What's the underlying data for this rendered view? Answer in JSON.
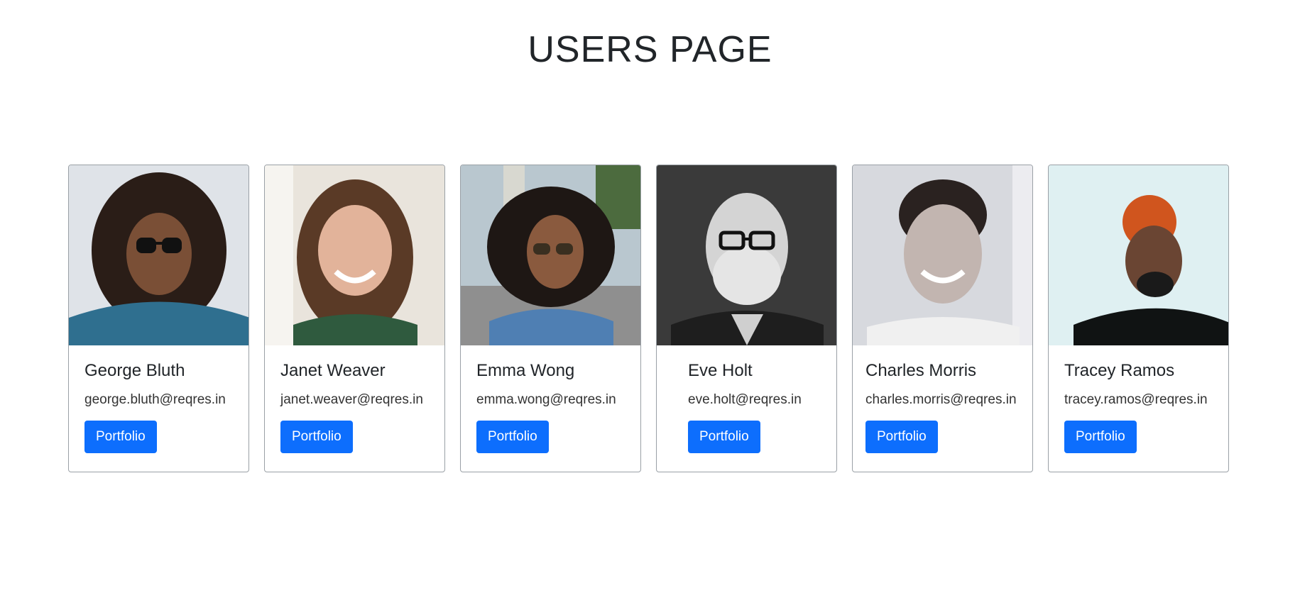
{
  "page": {
    "title": "USERS PAGE"
  },
  "users": [
    {
      "name": "George Bluth",
      "email": "george.bluth@reqres.in",
      "button_label": "Portfolio",
      "bg": "#dfe3e8",
      "skin": "#7a4f36",
      "hair": "#2a1d17",
      "shirt": "#2f6f8f"
    },
    {
      "name": "Janet Weaver",
      "email": "janet.weaver@reqres.in",
      "button_label": "Portfolio",
      "bg": "#e9e4dc",
      "skin": "#e2b39a",
      "hair": "#5a3a26",
      "shirt": "#2f5a3e"
    },
    {
      "name": "Emma Wong",
      "email": "emma.wong@reqres.in",
      "button_label": "Portfolio",
      "bg": "#b9c7cf",
      "skin": "#8a5a3e",
      "hair": "#1e1714",
      "shirt": "#4f7fb3"
    },
    {
      "name": "Eve Holt",
      "email": "eve.holt@reqres.in",
      "button_label": "Portfolio",
      "bg": "#3a3a3a",
      "skin": "#c9c9c9",
      "hair": "#e5e5e5",
      "shirt": "#1e1e1e"
    },
    {
      "name": "Charles Morris",
      "email": "charles.morris@reqres.in",
      "button_label": "Portfolio",
      "bg": "#d7d9de",
      "skin": "#c2b5b0",
      "hair": "#2a2220",
      "shirt": "#f0f0f0"
    },
    {
      "name": "Tracey Ramos",
      "email": "tracey.ramos@reqres.in",
      "button_label": "Portfolio",
      "bg": "#dff0f2",
      "skin": "#6a4533",
      "hair": "#d0551e",
      "shirt": "#101313"
    }
  ],
  "colors": {
    "primary_button": "#0d6efd",
    "card_border": "#9aa0a6"
  }
}
